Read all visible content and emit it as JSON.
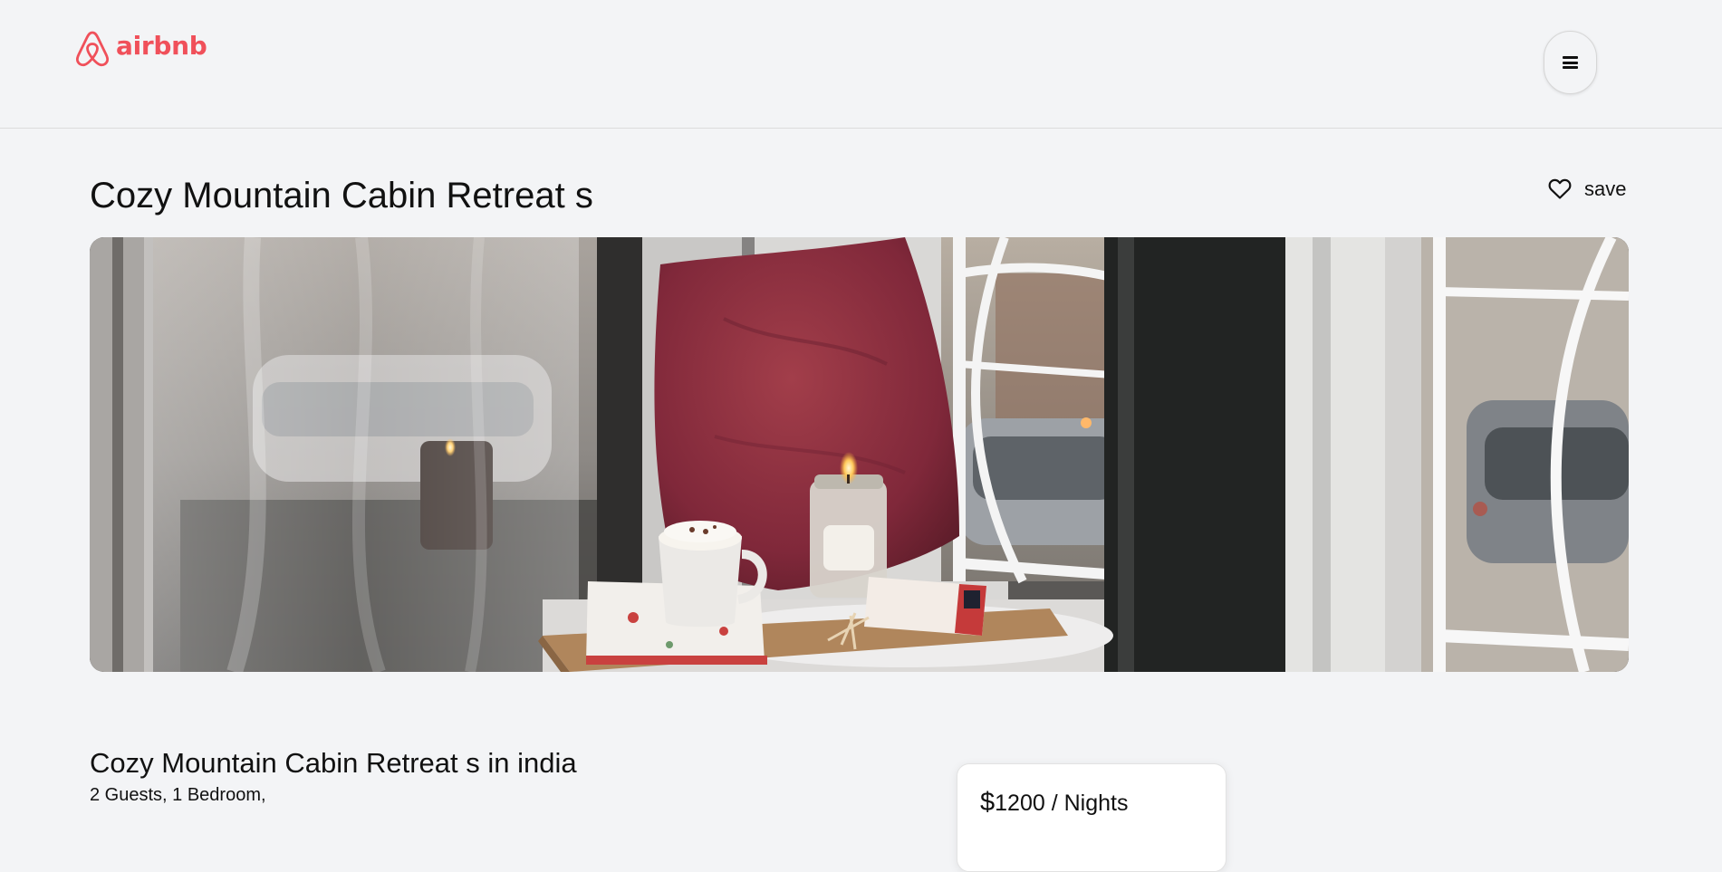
{
  "header": {
    "brand_name": "airbnb",
    "brand_color": "#f0505a",
    "logo_icon": "airbnb-logo-icon",
    "menu_icon": "hamburger-menu-icon"
  },
  "listing": {
    "title": "Cozy Mountain Cabin Retreat s",
    "save_label": "save",
    "save_icon": "heart-outline-icon",
    "heading": "Cozy Mountain Cabin Retreat s in india",
    "meta": "2 Guests, 1 Bedroom,"
  },
  "booking": {
    "currency_symbol": "$",
    "price": "1200",
    "unit": " / Nights"
  }
}
